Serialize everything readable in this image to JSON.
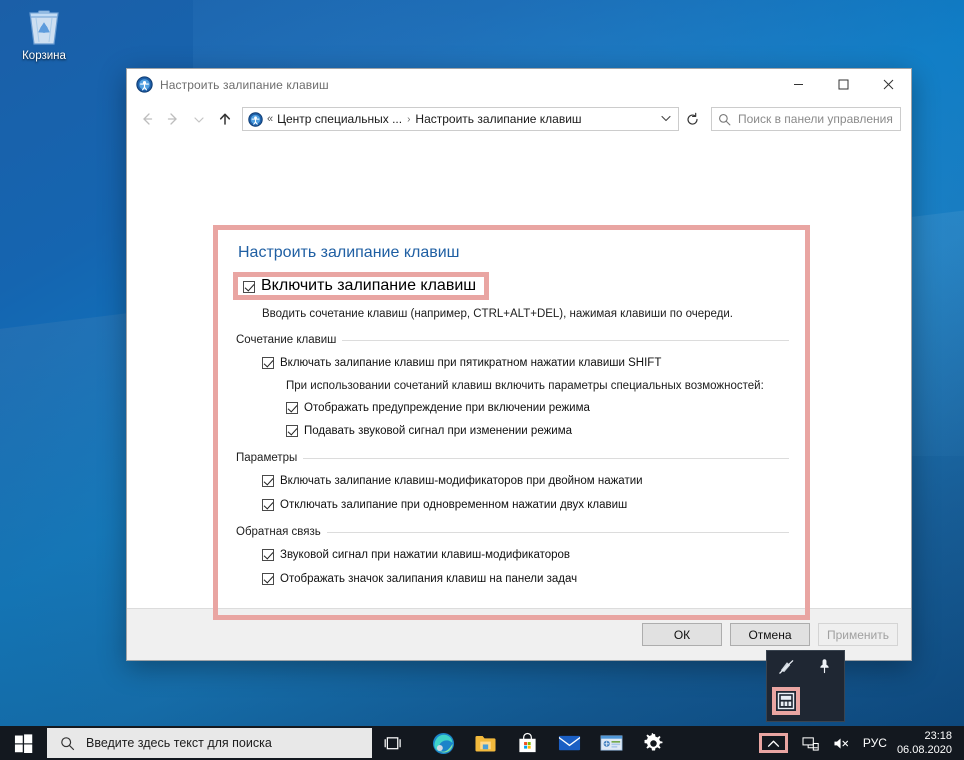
{
  "desktop": {
    "recycle_bin_label": "Корзина"
  },
  "window": {
    "title": "Настроить залипание клавиш",
    "title_icon": "accessibility-icon",
    "controls": {
      "minimize": "—",
      "maximize": "□",
      "close": "✕"
    },
    "nav": {
      "back_icon": "arrow-left-icon",
      "forward_icon": "arrow-right-icon",
      "history_icon": "chevron-down-icon",
      "up_icon": "arrow-up-icon",
      "refresh_icon": "refresh-icon"
    },
    "address": {
      "icon": "accessibility-icon",
      "overflow": "«",
      "crumb1": "Центр специальных ...",
      "separator": "›",
      "crumb2": "Настроить залипание клавиш",
      "dropdown_icon": "chevron-down-icon"
    },
    "search": {
      "icon": "search-icon",
      "placeholder": "Поиск в панели управления"
    },
    "page_title": "Настроить залипание клавиш",
    "master_checkbox": {
      "label": "Включить залипание клавиш",
      "checked": true,
      "highlighted": true
    },
    "hint": "Вводить сочетание клавиш (например, CTRL+ALT+DEL), нажимая клавиши по очереди.",
    "groups": [
      {
        "heading": "Сочетание клавиш",
        "items": [
          {
            "label": "Включать залипание клавиш при пятикратном нажатии клавиши SHIFT",
            "checked": true,
            "indent": 1
          }
        ],
        "note": "При использовании сочетаний клавиш включить параметры специальных возможностей:",
        "subitems": [
          {
            "label": "Отображать предупреждение при включении режима",
            "checked": true,
            "indent": 2
          },
          {
            "label": "Подавать звуковой сигнал при изменении режима",
            "checked": true,
            "indent": 2
          }
        ]
      },
      {
        "heading": "Параметры",
        "items": [
          {
            "label": "Включать залипание клавиш-модификаторов при двойном нажатии",
            "checked": true,
            "indent": 1
          },
          {
            "label": "Отключать залипание при одновременном нажатии двух клавиш",
            "checked": true,
            "indent": 1
          }
        ]
      },
      {
        "heading": "Обратная связь",
        "items": [
          {
            "label": "Звуковой сигнал при нажатии клавиш-модификаторов",
            "checked": true,
            "indent": 1
          },
          {
            "label": "Отображать значок залипания клавиш на панели задач",
            "checked": true,
            "indent": 1
          }
        ]
      }
    ],
    "buttons": {
      "ok": "ОК",
      "cancel": "Отмена",
      "apply": "Применить",
      "apply_disabled": true
    }
  },
  "tray_flyout": {
    "items": [
      {
        "icon": "pen-disabled-icon",
        "name": "windows-ink-workspace"
      },
      {
        "icon": "pin-icon",
        "name": "pin"
      },
      {
        "icon": "sticky-keys-icon",
        "name": "sticky-keys",
        "highlighted": true
      }
    ]
  },
  "taskbar": {
    "start_icon": "windows-logo-icon",
    "search": {
      "icon": "search-icon",
      "placeholder": "Введите здесь текст для поиска"
    },
    "task_view_icon": "task-view-icon",
    "apps": [
      {
        "name": "microsoft-edge",
        "icon": "edge-icon"
      },
      {
        "name": "file-explorer",
        "icon": "folder-icon"
      },
      {
        "name": "microsoft-store",
        "icon": "store-icon"
      },
      {
        "name": "mail",
        "icon": "mail-icon"
      },
      {
        "name": "control-panel",
        "icon": "control-panel-icon"
      },
      {
        "name": "settings",
        "icon": "gear-icon"
      }
    ],
    "tray": {
      "overflow_icon": "chevron-up-icon",
      "overflow_highlighted": true,
      "network_icon": "network-icon",
      "volume_icon": "volume-muted-icon",
      "language": "РУС",
      "time": "23:18",
      "date": "06.08.2020"
    }
  },
  "colors": {
    "highlight_border": "#e9a5a2",
    "accent_blue": "#0078d7",
    "page_title": "#1f5fa3",
    "taskbar": "#13181f"
  }
}
